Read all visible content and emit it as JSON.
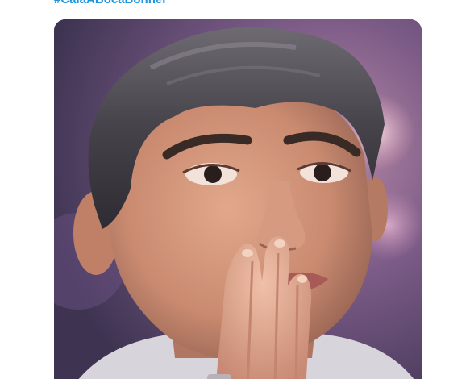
{
  "tweet": {
    "hashtag": "#CalaABocaBonner",
    "media": {
      "description_icon": "photo-of-man-icon"
    }
  }
}
